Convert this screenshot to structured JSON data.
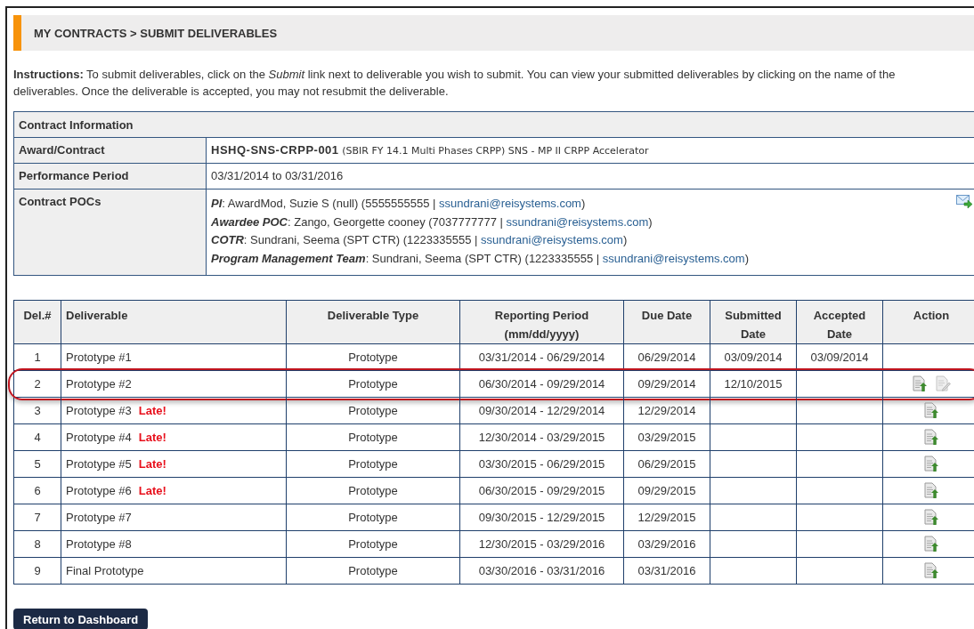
{
  "breadcrumb": "MY CONTRACTS > SUBMIT DELIVERABLES",
  "instructions": "**Instructions:** To submit deliverables, click on the *Submit* link next to deliverable you wish to submit. You can view your submitted deliverables by clicking on the name of the deliverables. Once the deliverable is accepted, you may not resubmit the deliverable.",
  "contract_info": {
    "title": "Contract Information",
    "award_label": "Award/Contract",
    "award_number": "HSHQ-SNS-CRPP-001",
    "award_title": "(SBIR FY 14.1 Multi Phases CRPP) SNS - MP II CRPP Accelerator",
    "period_label": "Performance Period",
    "period": "03/31/2014 to 03/31/2016",
    "pocs_label": "Contract POCs",
    "pocs": [
      {
        "role": "PI",
        "details": ": AwardMod, Suzie S (null) (5555555555 | ",
        "email": "ssundrani@reisystems.com",
        "suffix": ")"
      },
      {
        "role": "Awardee POC",
        "details": ": Zango, Georgette cooney (7037777777 | ",
        "email": "ssundrani@reisystems.com",
        "suffix": ")"
      },
      {
        "role": "COTR",
        "details": ": Sundrani, Seema (SPT CTR) (1223335555 | ",
        "email": "ssundrani@reisystems.com",
        "suffix": ")"
      },
      {
        "role": "Program Management Team",
        "details": ": Sundrani, Seema (SPT CTR) (1223335555 | ",
        "email": "ssundrani@reisystems.com",
        "suffix": ")"
      }
    ]
  },
  "table": {
    "columns": [
      "Del.#",
      "Deliverable",
      "Deliverable Type",
      "Reporting Period (mm/dd/yyyy)",
      "Due Date",
      "Submitted Date",
      "Accepted Date",
      "Action"
    ],
    "rows": [
      {
        "num": "1",
        "name": "Prototype #1",
        "type": "Prototype",
        "period": "03/31/2014 - 06/29/2014",
        "due": "06/29/2014",
        "submitted": "03/09/2014",
        "accepted": "03/09/2014",
        "actions": [],
        "highlighted": false
      },
      {
        "num": "2",
        "name": "Prototype #2",
        "type": "Prototype",
        "period": "06/30/2014 - 09/29/2014",
        "due": "09/29/2014",
        "submitted": "12/10/2015",
        "actions": [
          {
            "kind": "upload"
          },
          {
            "kind": "edit"
          }
        ],
        "highlighted": true
      },
      {
        "num": "3",
        "name": "Prototype #3",
        "late": "Late!",
        "type": "Prototype",
        "period": "09/30/2014 - 12/29/2014",
        "due": "12/29/2014",
        "actions": [
          {
            "kind": "upload"
          }
        ],
        "highlighted": false
      },
      {
        "num": "4",
        "name": "Prototype #4",
        "late": "Late!",
        "type": "Prototype",
        "period": "12/30/2014 - 03/29/2015",
        "due": "03/29/2015",
        "actions": [
          {
            "kind": "upload"
          }
        ],
        "highlighted": false
      },
      {
        "num": "5",
        "name": "Prototype #5",
        "late": "Late!",
        "type": "Prototype",
        "period": "03/30/2015 - 06/29/2015",
        "due": "06/29/2015",
        "actions": [
          {
            "kind": "upload"
          }
        ],
        "highlighted": false
      },
      {
        "num": "6",
        "name": "Prototype #6",
        "late": "Late!",
        "type": "Prototype",
        "period": "06/30/2015 - 09/29/2015",
        "due": "09/29/2015",
        "actions": [
          {
            "kind": "upload"
          }
        ],
        "highlighted": false
      },
      {
        "num": "7",
        "name": "Prototype #7",
        "type": "Prototype",
        "period": "09/30/2015 - 12/29/2015",
        "due": "12/29/2015",
        "actions": [
          {
            "kind": "upload"
          }
        ],
        "highlighted": false
      },
      {
        "num": "8",
        "name": "Prototype #8",
        "type": "Prototype",
        "period": "12/30/2015 - 03/29/2016",
        "due": "03/29/2016",
        "actions": [
          {
            "kind": "upload"
          }
        ],
        "highlighted": false
      },
      {
        "num": "9",
        "name": "Final Prototype",
        "type": "Prototype",
        "period": "03/30/2016 - 03/31/2016",
        "due": "03/31/2016",
        "actions": [
          {
            "kind": "upload"
          }
        ],
        "highlighted": false
      }
    ]
  },
  "button": "Return to Dashboard"
}
